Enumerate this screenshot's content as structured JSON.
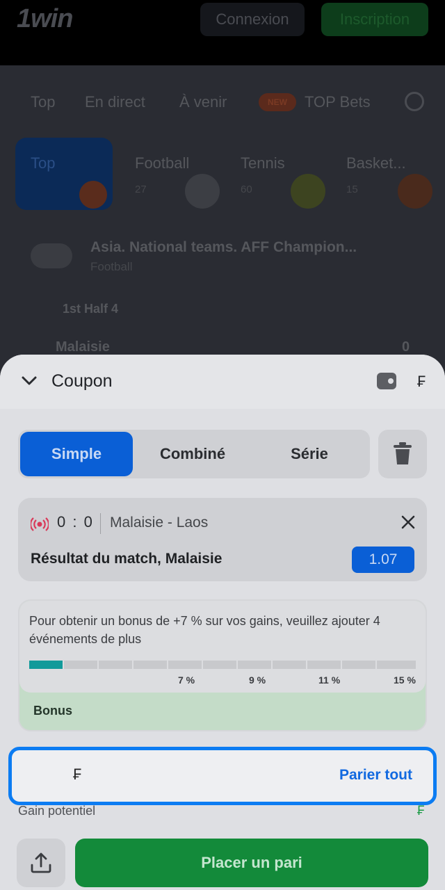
{
  "header": {
    "logo_text": "1win",
    "login_label": "Connexion",
    "signup_label": "Inscription"
  },
  "nav": {
    "tabs": [
      "Top",
      "En direct",
      "À venir",
      "TOP Bets"
    ],
    "badge": "NEW"
  },
  "sports": [
    {
      "name": "Top",
      "count": ""
    },
    {
      "name": "Football",
      "count": "27"
    },
    {
      "name": "Tennis",
      "count": "60"
    },
    {
      "name": "Basket...",
      "count": "15"
    }
  ],
  "event": {
    "league": "Asia. National teams. AFF Champion...",
    "sport": "Football",
    "period": "1st Half 4",
    "team1": "Malaisie",
    "team1_score": "0"
  },
  "coupon": {
    "title": "Coupon",
    "currency": "₣",
    "modes": [
      "Simple",
      "Combiné",
      "Série"
    ],
    "active_mode": "Simple",
    "bet": {
      "score": "0 : 0",
      "match": "Malaisie - Laos",
      "market": "Résultat du match, Malaisie",
      "odds": "1.07"
    },
    "bonus": {
      "message": "Pour obtenir un bonus de +7 % sur vos gains, veuillez ajouter 4 événements de plus",
      "progress_fraction": 0.09,
      "milestones": [
        "7 %",
        "9 %",
        "11 %",
        "15 %"
      ],
      "label": "Bonus"
    },
    "stake": {
      "currency": "₣",
      "bet_all_label": "Parier tout"
    },
    "potential_gain_label": "Gain potentiel",
    "potential_gain_currency": "₣",
    "place_bet_label": "Placer un pari"
  },
  "colors": {
    "accent_blue": "#0a5fd6",
    "focus_border": "#0c7cf2",
    "place_green": "#138a3a",
    "progress_teal": "#129a9a"
  }
}
